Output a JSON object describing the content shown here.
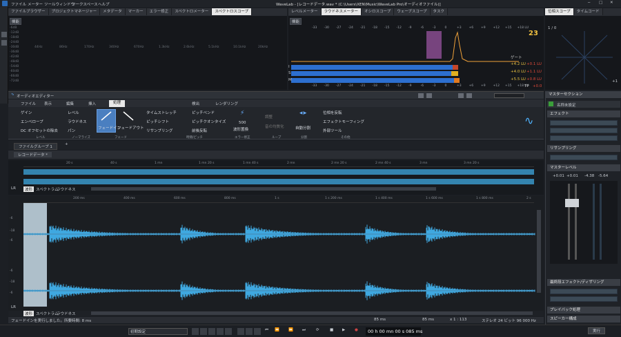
{
  "menu": [
    "ファイル",
    "メーター",
    "ツールウィンドウ",
    "ワークスペース",
    "ヘルプ"
  ],
  "title": "WaveLab - [レコードデータ.wav * (C:\\Users\\XEN\\Music\\WaveLab Pro\\オーディオファイル)]",
  "top_tabs": [
    "ファイルブラウザー",
    "プロジェクトマネージャー",
    "メタデータ",
    "マーカー",
    "エラー修正",
    "スペクトロメーター",
    "スペクトロスコープ"
  ],
  "spectro": {
    "label": "機能",
    "db_labels": [
      "-6dB",
      "-12dB",
      "-18dB",
      "-24dB",
      "-30dB",
      "-36dB",
      "-42dB",
      "-48dB",
      "-54dB",
      "-60dB",
      "-66dB",
      "-72dB"
    ],
    "freq_labels": [
      "44Hz",
      "86Hz",
      "170Hz",
      "340Hz",
      "670Hz",
      "1.3kHz",
      "2.6kHz",
      "5.1kHz",
      "10.1kHz",
      "20kHz"
    ]
  },
  "meter_tabs": [
    "レベルメーター",
    "ラウドネスメーター",
    "オシロスコープ",
    "ウェーブスコープ",
    "タスク"
  ],
  "loudness": {
    "label": "機能",
    "scale": [
      "-33",
      "-30",
      "-27",
      "-24",
      "-21",
      "-18",
      "-15",
      "-12",
      "-9",
      "-6",
      "-3",
      "0",
      "+3",
      "+6",
      "+9",
      "+12",
      "+15",
      "+18 LU"
    ],
    "rows": [
      {
        "label": "I",
        "value": "+4.2 LU",
        "peak": "+0.1 LU"
      },
      {
        "label": "S",
        "value": "+4.0 LU",
        "peak": "+1.1 LU"
      },
      {
        "label": "M",
        "value": "+5.5 LU",
        "peak": "+0.8 LU"
      }
    ],
    "gate_label": "ゲート",
    "tp_label": "TP",
    "tp_value": "+0.0"
  },
  "phase_tabs": [
    "位相スコープ",
    "タイムコード"
  ],
  "phase": {
    "label": "1 / 0",
    "corner": "+1"
  },
  "editor": {
    "title": "オーディオエディター",
    "ribbon_tabs": [
      "ファイル",
      "表示",
      "編集",
      "挿入",
      "処理",
      "検出",
      "レンダリング"
    ],
    "active_tab": "処理",
    "groups": {
      "level": {
        "label": "レベル",
        "items": [
          "ゲイン",
          "エンベロープ",
          "DC オフセットの除去"
        ]
      },
      "normalize": {
        "label": "ノーマライズ",
        "items": [
          "レベル",
          "ラウドネス",
          "パン"
        ]
      },
      "fade": {
        "label": "フェード",
        "items": [
          "フェードイン",
          "フェードアウト"
        ]
      },
      "time_pitch": {
        "label": "時間/ピッチ",
        "items": [
          "タイムストレッチ",
          "ピッチシフト",
          "リサンプリング",
          "ピッチベンド",
          "ピッチクオンタイズ",
          "前後反転"
        ]
      },
      "error": {
        "label": "エラー修正",
        "items": [
          "500",
          "波形置換"
        ]
      },
      "loop": {
        "label": "ループ",
        "items": [
          "調整",
          "音の均質化"
        ]
      },
      "split": {
        "label": "分割",
        "items": [
          "自動分割"
        ]
      },
      "other": {
        "label": "その他",
        "items": [
          "位相を反転",
          "エフェクトモーフィング",
          "外部ツール"
        ]
      }
    },
    "file_group": "ファイルグループ 1",
    "file_tab": "レコードデータ *",
    "overview_ticks": [
      "20 s",
      "40 s",
      "1 mn",
      "1 mn 20 s",
      "1 mn 40 s",
      "2 mn",
      "2 mn 20 s",
      "2 mn 40 s",
      "3 mn",
      "3 mn 20 s"
    ],
    "main_ticks": [
      "200 ms",
      "400 ms",
      "600 ms",
      "800 ms",
      "1 s",
      "1 s 200 ms",
      "1 s 400 ms",
      "1 s 600 ms",
      "1 s 800 ms",
      "2 s"
    ],
    "view_tabs": [
      "波形",
      "スペクトラム",
      "ラウドネス"
    ],
    "lr": "LR",
    "db_left": [
      "-6",
      "-18",
      "-6",
      "-6",
      "-18",
      "-6"
    ],
    "status": "フェードインを実行しました。所要時間: 8 ms",
    "status_sel": "85 ms",
    "status_sel2": "85 ms",
    "status_zoom": "x 1 : 113",
    "status_format": "ステレオ 24 ビット 96 000 Hz"
  },
  "master": {
    "title": "マスターセクション",
    "preset": "名称未設定",
    "effects": "エフェクト",
    "resample": "リサンプリング",
    "master_level": "マスターレベル",
    "level_values": [
      "+0.01",
      "+0.01",
      "-4.38",
      "-5.64"
    ],
    "final": "最終段エフェクト/ディザリング",
    "playback": "プレイバック処理",
    "speaker": "スピーカー構成",
    "render": "実行"
  },
  "transport": {
    "preset": "初期設定",
    "time": "00 h 00 mn 00 s 085 ms"
  },
  "colors": {
    "waveform": "#3fa8e0",
    "accent": "#4fb3ff",
    "loudness_bar": "#2d6fcf",
    "loudness_bar2": "#c6462a",
    "marker_bg": "#cc77cc"
  }
}
